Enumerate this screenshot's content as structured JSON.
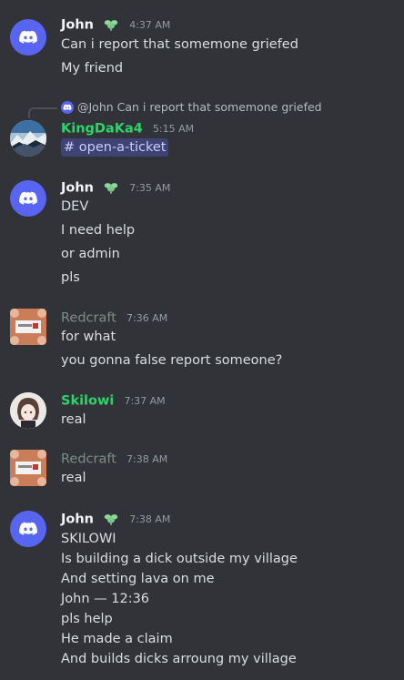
{
  "colors": {
    "background": "#313338",
    "discord_blurple": "#5865f2",
    "green_name": "#2dd46a",
    "red_name_gray": "#7e8e87",
    "badge_green": "#8fd89b"
  },
  "messages": [
    {
      "author": "John",
      "time": "4:37 AM",
      "lines": [
        "Can i report that somemone griefed",
        "My friend"
      ]
    },
    {
      "reply_to": "@John Can i report that somemone griefed",
      "author": "KingDaKa4",
      "time": "5:15 AM",
      "channel_mention": "# open-a-ticket"
    },
    {
      "author": "John",
      "time": "7:35 AM",
      "lines": [
        "DEV",
        "I need help",
        "or admin",
        "pls"
      ]
    },
    {
      "author": "Redcraft",
      "time": "7:36 AM",
      "lines": [
        "for what",
        "you gonna false report someone?"
      ]
    },
    {
      "author": "Skilowi",
      "time": "7:37 AM",
      "lines": [
        "real"
      ]
    },
    {
      "author": "Redcraft",
      "time": "7:38 AM",
      "lines": [
        "real"
      ]
    },
    {
      "author": "John",
      "time": "7:38 AM",
      "lines": [
        "SKILOWI",
        "Is building a dick outside my village",
        "And setting lava on me",
        "John — 12:36",
        "pls help",
        "He made a claim",
        "And builds dicks arroung my village"
      ]
    }
  ]
}
